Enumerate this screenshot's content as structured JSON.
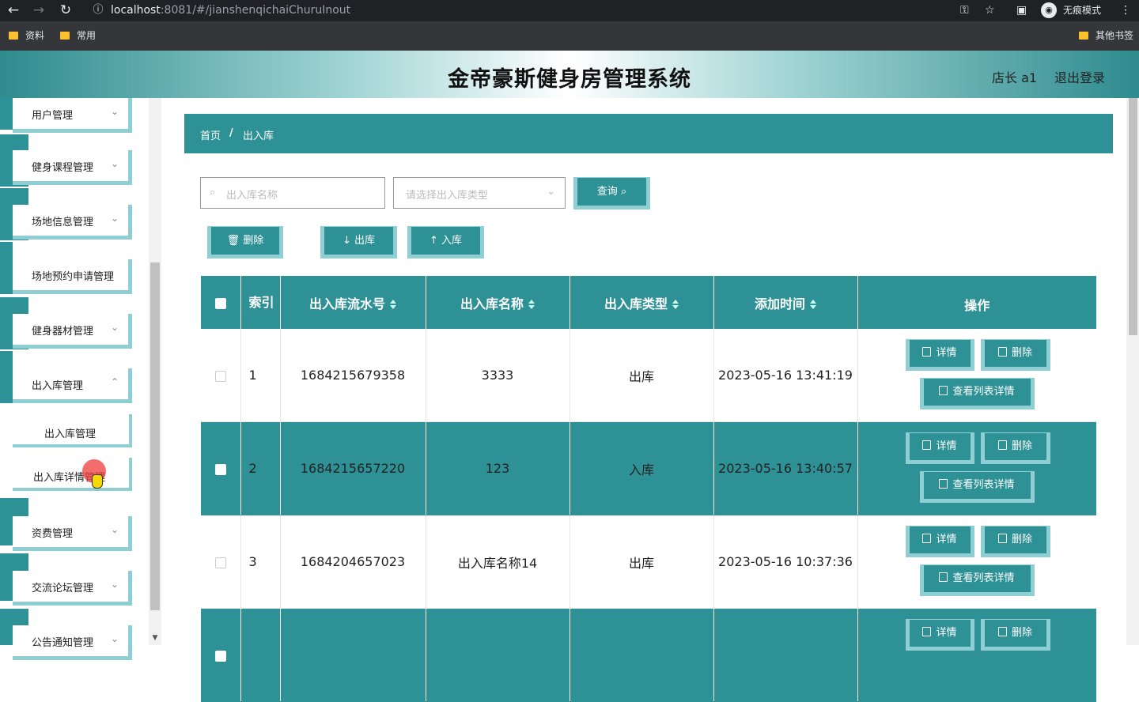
{
  "browser": {
    "url_host": "localhost",
    "url_path": ":8081/#/jianshenqichaiChuruInout",
    "incognito_label": "无痕模式",
    "bookmarks": [
      "资料",
      "常用"
    ],
    "other_bookmarks": "其他书签"
  },
  "header": {
    "title": "金帝豪斯健身房管理系统",
    "user": "店长 a1",
    "logout": "退出登录"
  },
  "sidebar": {
    "items": [
      {
        "label": "用户管理"
      },
      {
        "label": "健身课程管理"
      },
      {
        "label": "场地信息管理"
      },
      {
        "label": "场地预约申请管理"
      },
      {
        "label": "健身器材管理"
      },
      {
        "label": "出入库管理"
      },
      {
        "label": "出入库管理"
      },
      {
        "label": "出入库详情管理"
      },
      {
        "label": "资费管理"
      },
      {
        "label": "交流论坛管理"
      },
      {
        "label": "公告通知管理"
      }
    ]
  },
  "breadcrumb": {
    "home": "首页",
    "sep": "/",
    "current": "出入库"
  },
  "search": {
    "name_placeholder": "出入库名称",
    "type_placeholder": "请选择出入库类型",
    "query_label": "查询"
  },
  "actions": {
    "delete": "删除",
    "out": "出库",
    "in": "入库"
  },
  "table": {
    "headers": [
      "索引",
      "出入库流水号",
      "出入库名称",
      "出入库类型",
      "添加时间",
      "操作"
    ],
    "rows": [
      {
        "index": "1",
        "serial": "1684215679358",
        "name": "3333",
        "type": "出库",
        "time": "2023-05-16 13:41:19"
      },
      {
        "index": "2",
        "serial": "1684215657220",
        "name": "123",
        "type": "入库",
        "time": "2023-05-16 13:40:57"
      },
      {
        "index": "3",
        "serial": "1684204657023",
        "name": "出入库名称14",
        "type": "出库",
        "time": "2023-05-16 10:37:36"
      },
      {
        "index": "",
        "serial": "",
        "name": "",
        "type": "",
        "time": ""
      }
    ],
    "op_detail": "详情",
    "op_delete": "删除",
    "op_list_detail": "查看列表详情"
  }
}
